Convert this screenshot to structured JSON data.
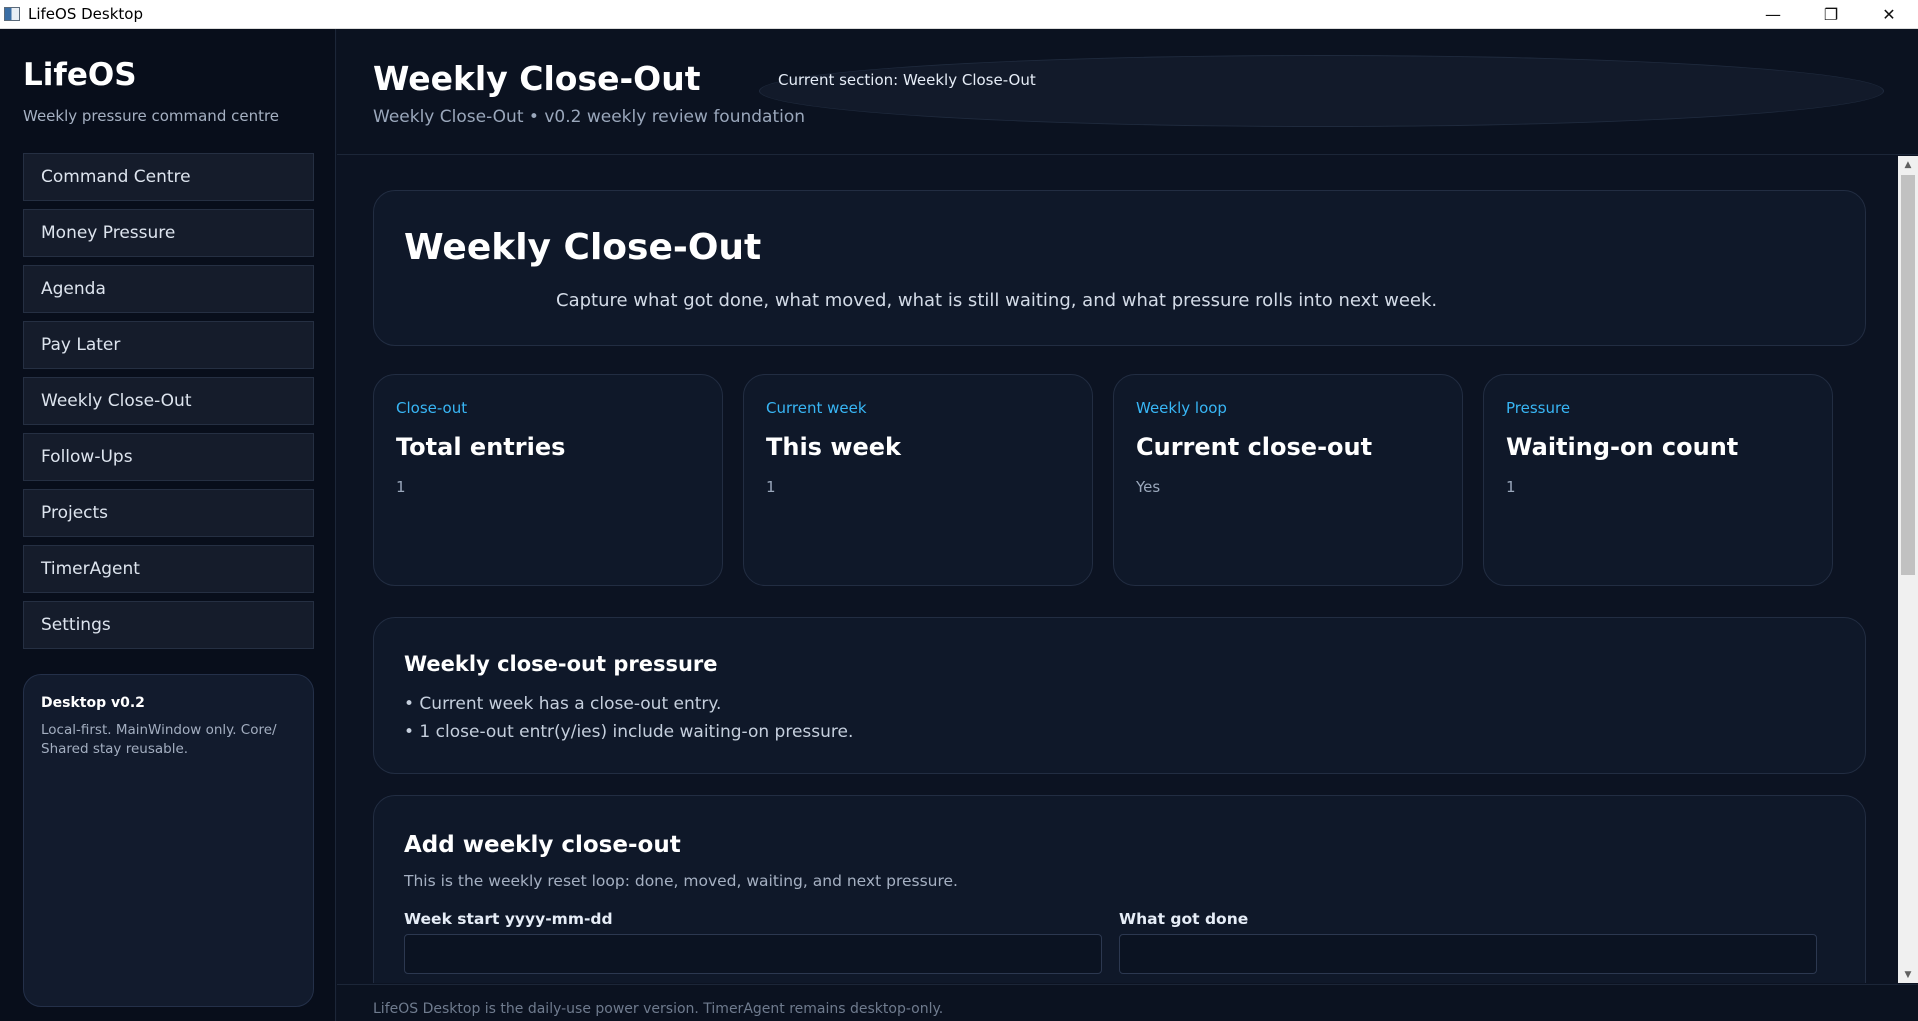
{
  "window": {
    "title": "LifeOS Desktop",
    "controls": {
      "minimize": "—",
      "restore": "❐",
      "close": "✕"
    }
  },
  "sidebar": {
    "brand": "LifeOS",
    "tagline": "Weekly pressure command centre",
    "items": [
      {
        "label": "Command Centre"
      },
      {
        "label": "Money Pressure"
      },
      {
        "label": "Agenda"
      },
      {
        "label": "Pay Later"
      },
      {
        "label": "Weekly Close-Out"
      },
      {
        "label": "Follow-Ups"
      },
      {
        "label": "Projects"
      },
      {
        "label": "TimerAgent"
      },
      {
        "label": "Settings"
      }
    ],
    "info": {
      "title": "Desktop v0.2",
      "text": "Local-first. MainWindow only. Core/ Shared stay reusable."
    }
  },
  "header": {
    "title": "Weekly Close-Out",
    "subtitle": "Weekly Close-Out • v0.2 weekly review foundation",
    "current_section": "Current section: Weekly Close-Out"
  },
  "hero": {
    "title": "Weekly Close-Out",
    "description": "Capture what got done, what moved, what is still waiting, and what pressure rolls into next week."
  },
  "stats": [
    {
      "tag": "Close-out",
      "title": "Total entries",
      "value": "1"
    },
    {
      "tag": "Current week",
      "title": "This week",
      "value": "1"
    },
    {
      "tag": "Weekly loop",
      "title": "Current close-out",
      "value": "Yes"
    },
    {
      "tag": "Pressure",
      "title": "Waiting-on count",
      "value": "1"
    }
  ],
  "pressure": {
    "title": "Weekly close-out pressure",
    "items": [
      "• Current week has a close-out entry.",
      "• 1 close-out entr(y/ies) include waiting-on pressure."
    ]
  },
  "add_form": {
    "title": "Add weekly close-out",
    "description": "This is the weekly reset loop: done, moved, waiting, and next pressure.",
    "week_start_label": "Week start yyyy-mm-dd",
    "week_start_value": "",
    "done_label": "What got done",
    "done_value": ""
  },
  "scrollbar": {
    "up": "▲",
    "down": "▼"
  },
  "footer": {
    "text": "LifeOS Desktop is the daily-use power version. TimerAgent remains desktop-only."
  }
}
